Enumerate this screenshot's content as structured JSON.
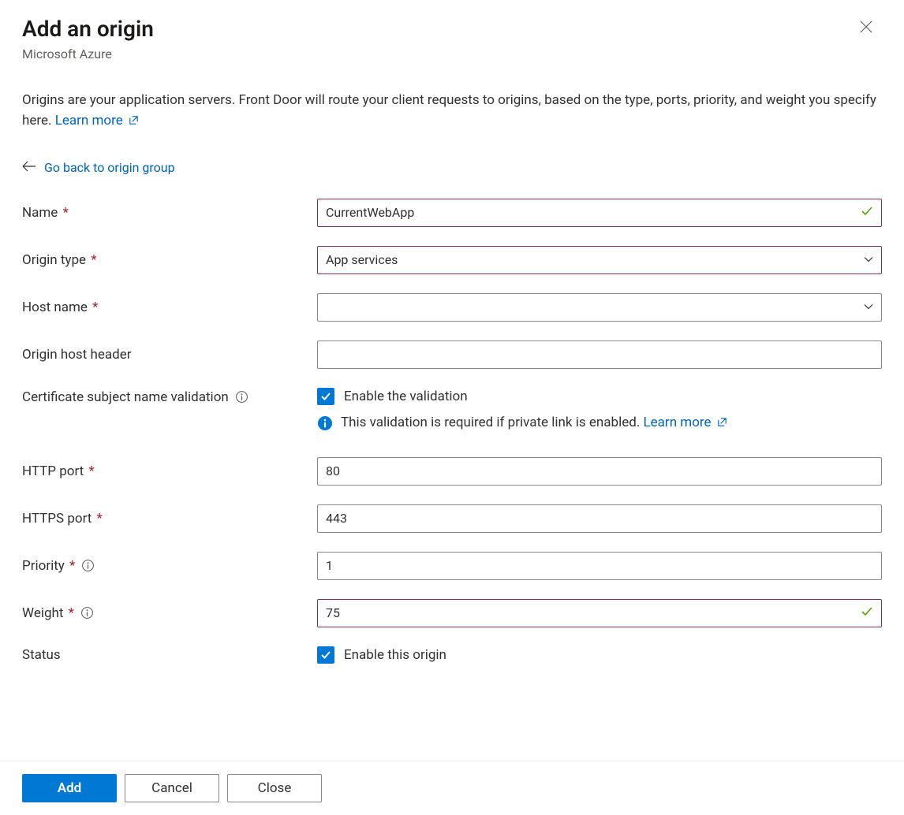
{
  "header": {
    "title": "Add an origin",
    "subtitle": "Microsoft Azure"
  },
  "description": {
    "text": "Origins are your application servers. Front Door will route your client requests to origins, based on the type, ports, priority, and weight you specify here. ",
    "learn_more": "Learn more"
  },
  "back_link": "Go back to origin group",
  "fields": {
    "name": {
      "label": "Name",
      "value": "CurrentWebApp"
    },
    "origin_type": {
      "label": "Origin type",
      "value": "App services"
    },
    "host_name": {
      "label": "Host name",
      "value": ""
    },
    "origin_host_header": {
      "label": "Origin host header",
      "value": ""
    },
    "cert_validation": {
      "label": "Certificate subject name validation",
      "checkbox_label": "Enable the validation",
      "checked": true,
      "info_text": "This validation is required if private link is enabled. ",
      "info_link": "Learn more"
    },
    "http_port": {
      "label": "HTTP port",
      "value": "80"
    },
    "https_port": {
      "label": "HTTPS port",
      "value": "443"
    },
    "priority": {
      "label": "Priority",
      "value": "1"
    },
    "weight": {
      "label": "Weight",
      "value": "75"
    },
    "status": {
      "label": "Status",
      "checkbox_label": "Enable this origin",
      "checked": true
    }
  },
  "footer": {
    "add": "Add",
    "cancel": "Cancel",
    "close": "Close"
  }
}
